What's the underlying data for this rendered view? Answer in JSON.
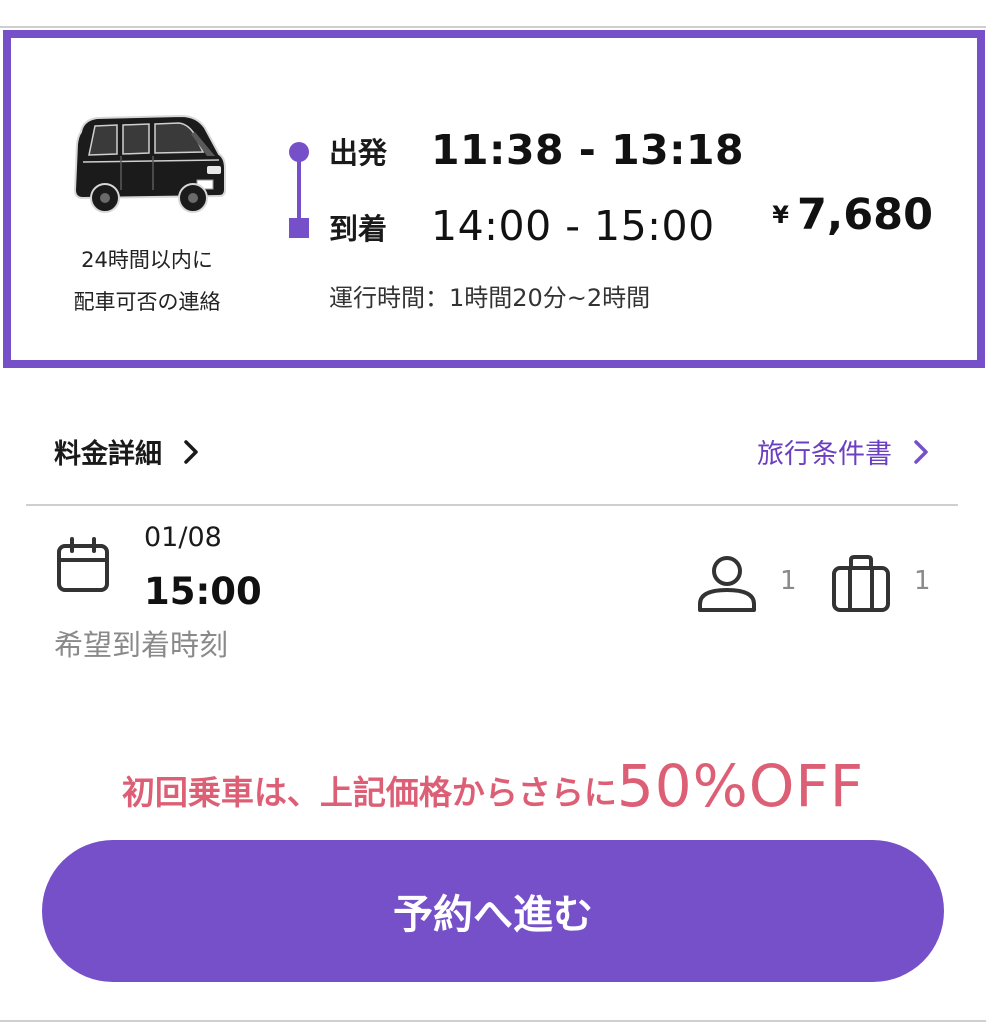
{
  "ride": {
    "notice_line1": "24時間以内に",
    "notice_line2": "配車可否の連絡",
    "departure_label": "出発",
    "departure_time": "11:38 - 13:18",
    "arrival_label": "到着",
    "arrival_time": "14:00 - 15:00",
    "duration": "運行時間：1時間20分~2時間",
    "currency": "¥",
    "price": "7,680",
    "accent_color": "#7650c8"
  },
  "links": {
    "fare_details": "料金詳細",
    "travel_terms": "旅行条件書",
    "terms_color": "#6c3fc0"
  },
  "trip": {
    "date": "01/08",
    "time": "15:00",
    "time_caption": "希望到着時刻",
    "passengers": "1",
    "luggage": "1"
  },
  "promo": {
    "text": "初回乗車は、上記価格からさらに",
    "highlight": "50%OFF",
    "color": "#dd5f76"
  },
  "cta": {
    "label": "予約へ進む"
  },
  "icons": {
    "vehicle": "van-icon",
    "fare_chevron": "chevron-right-icon",
    "terms_chevron": "chevron-right-icon",
    "date": "calendar-icon",
    "passenger": "person-icon",
    "luggage": "suitcase-icon"
  }
}
